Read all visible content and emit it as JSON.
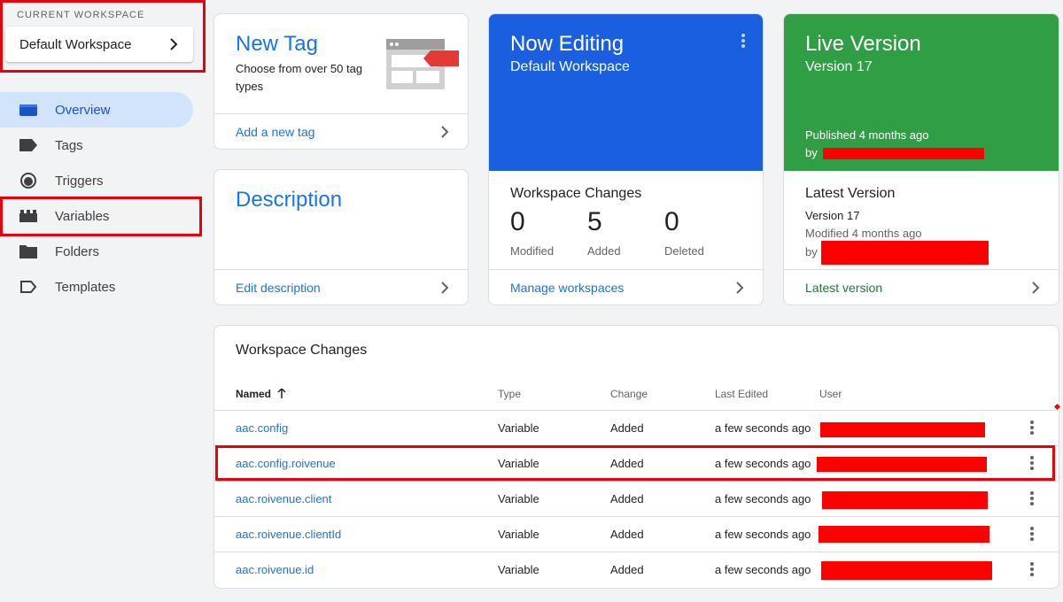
{
  "workspace": {
    "label": "CURRENT WORKSPACE",
    "name": "Default Workspace"
  },
  "nav": [
    {
      "label": "Overview",
      "icon": "overview-icon",
      "active": true
    },
    {
      "label": "Tags",
      "icon": "tag-icon"
    },
    {
      "label": "Triggers",
      "icon": "trigger-icon"
    },
    {
      "label": "Variables",
      "icon": "variables-icon"
    },
    {
      "label": "Folders",
      "icon": "folder-icon"
    },
    {
      "label": "Templates",
      "icon": "templates-icon"
    }
  ],
  "new_tag": {
    "title": "New Tag",
    "subtitle": "Choose from over 50 tag types",
    "link": "Add a new tag"
  },
  "description": {
    "title": "Description",
    "link": "Edit description"
  },
  "now_editing": {
    "title": "Now Editing",
    "workspace": "Default Workspace",
    "changes_title": "Workspace Changes",
    "modified": "0",
    "modified_label": "Modified",
    "added": "5",
    "added_label": "Added",
    "deleted": "0",
    "deleted_label": "Deleted",
    "link": "Manage workspaces",
    "color": "#1a5fe0"
  },
  "live_version": {
    "title": "Live Version",
    "version": "Version 17",
    "published": "Published 4 months ago",
    "by": "by",
    "latest_title": "Latest Version",
    "latest_version": "Version 17",
    "latest_modified": "Modified 4 months ago",
    "latest_by": "by",
    "link": "Latest version",
    "color": "#2f9e44"
  },
  "changes_table": {
    "title": "Workspace Changes",
    "columns": {
      "name": "Named",
      "type": "Type",
      "change": "Change",
      "last_edited": "Last Edited",
      "user": "User"
    },
    "rows": [
      {
        "name": "aac.config",
        "type": "Variable",
        "change": "Added",
        "last_edited": "a few seconds ago"
      },
      {
        "name": "aac.config.roivenue",
        "type": "Variable",
        "change": "Added",
        "last_edited": "a few seconds ago"
      },
      {
        "name": "aac.roivenue.client",
        "type": "Variable",
        "change": "Added",
        "last_edited": "a few seconds ago"
      },
      {
        "name": "aac.roivenue.clientId",
        "type": "Variable",
        "change": "Added",
        "last_edited": "a few seconds ago"
      },
      {
        "name": "aac.roivenue.id",
        "type": "Variable",
        "change": "Added",
        "last_edited": "a few seconds ago"
      }
    ]
  }
}
